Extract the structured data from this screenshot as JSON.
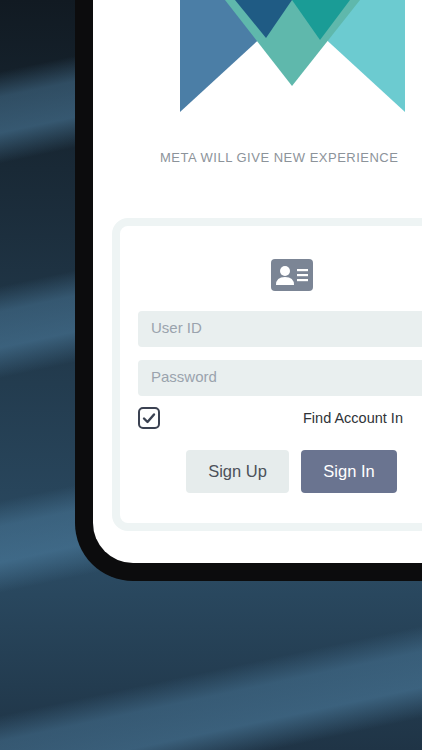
{
  "tagline": "META WILL GIVE NEW EXPERIENCE",
  "login": {
    "fields": [
      {
        "placeholder": "User ID",
        "kind": "text"
      },
      {
        "placeholder": "Password",
        "kind": "password"
      }
    ],
    "remember": {
      "checked": true
    },
    "find_account": "Find Account In",
    "buttons": [
      {
        "label": "Sign Up",
        "kind": "secondary"
      },
      {
        "label": "Sign In",
        "kind": "primary"
      }
    ]
  }
}
